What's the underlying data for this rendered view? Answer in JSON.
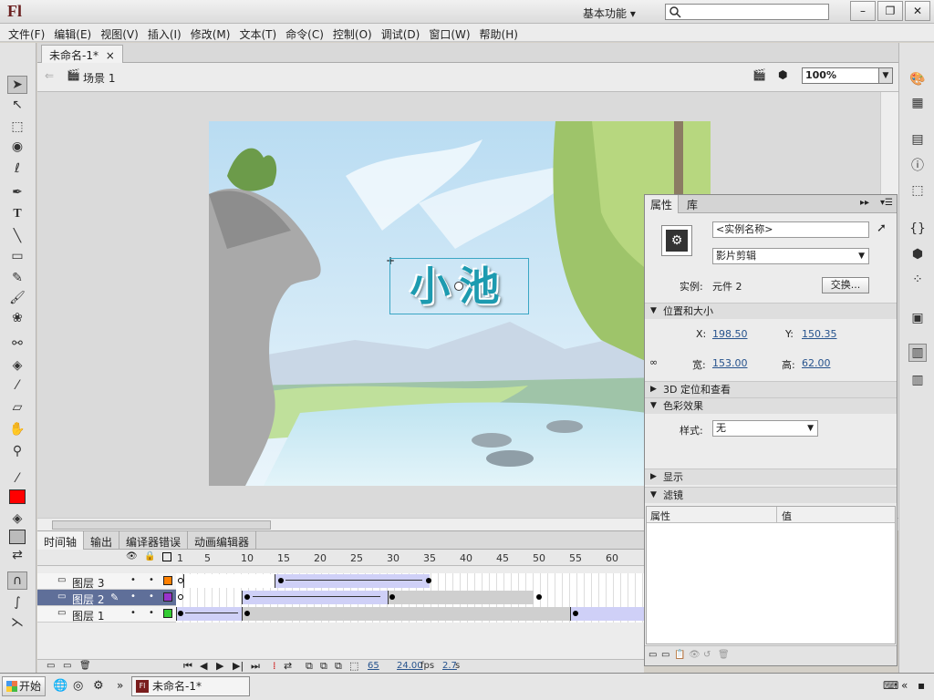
{
  "app": {
    "logo": "Fl",
    "workspace": "基本功能 ▾",
    "search_placeholder": ""
  },
  "window_buttons": [
    "–",
    "❐",
    "✕"
  ],
  "menu": [
    "文件(F)",
    "编辑(E)",
    "视图(V)",
    "插入(I)",
    "修改(M)",
    "文本(T)",
    "命令(C)",
    "控制(O)",
    "调试(D)",
    "窗口(W)",
    "帮助(H)"
  ],
  "document": {
    "tab": "未命名-1*",
    "tab_close": "×",
    "scene": "场景 1",
    "zoom": "100%"
  },
  "stage": {
    "title": "小池",
    "background_color": "#cde6f5"
  },
  "timeline": {
    "tabs": [
      "时间轴",
      "输出",
      "编译器错误",
      "动画编辑器"
    ],
    "frame_numbers": [
      "1",
      "5",
      "10",
      "15",
      "20",
      "25",
      "30",
      "35",
      "40",
      "45",
      "50",
      "55",
      "60"
    ],
    "layers": [
      {
        "name": "图层 3",
        "color": "#ff8000",
        "selected": false
      },
      {
        "name": "图层 2",
        "color": "#9933cc",
        "selected": true
      },
      {
        "name": "图层 1",
        "color": "#33cc33",
        "selected": false
      }
    ],
    "current_frame": "65",
    "fps": "24.00",
    "fps_unit": "fps",
    "elapsed": "2.7",
    "elapsed_unit": "s"
  },
  "properties": {
    "tabs": [
      "属性",
      "库"
    ],
    "instance_name_placeholder": "<实例名称>",
    "type": "影片剪辑",
    "instance_label": "实例:",
    "instance_value": "元件 2",
    "swap_button": "交换...",
    "section_position": "位置和大小",
    "x_label": "X:",
    "x_value": "198.50",
    "y_label": "Y:",
    "y_value": "150.35",
    "w_label": "宽:",
    "w_value": "153.00",
    "h_label": "高:",
    "h_value": "62.00",
    "section_3d": "3D 定位和查看",
    "section_color": "色彩效果",
    "style_label": "样式:",
    "style_value": "无",
    "section_display": "显示",
    "section_filter": "滤镜",
    "filter_col_prop": "属性",
    "filter_col_value": "值"
  },
  "taskbar": {
    "start": "开始",
    "task": "未命名-1*",
    "task_icon": "Fl",
    "more": "»"
  }
}
